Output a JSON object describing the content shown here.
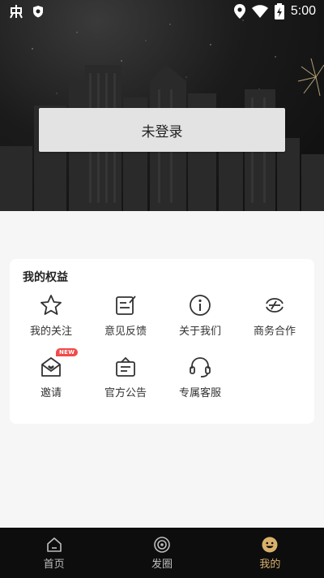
{
  "status_bar": {
    "time": "5:00",
    "left_icons": [
      "app-logo-icon",
      "shield-icon"
    ],
    "right_icons": [
      "location-icon",
      "wifi-icon",
      "battery-icon"
    ]
  },
  "login": {
    "label": "未登录"
  },
  "benefits": {
    "title": "我的权益",
    "items": [
      {
        "label": "我的关注",
        "icon": "star-icon"
      },
      {
        "label": "意见反馈",
        "icon": "feedback-icon"
      },
      {
        "label": "关于我们",
        "icon": "info-icon"
      },
      {
        "label": "商务合作",
        "icon": "cooperation-icon"
      },
      {
        "label": "邀请",
        "icon": "invite-icon",
        "badge": "NEW"
      },
      {
        "label": "官方公告",
        "icon": "announcement-icon"
      },
      {
        "label": "专属客服",
        "icon": "headset-icon"
      }
    ]
  },
  "bottom_nav": {
    "items": [
      {
        "label": "首页",
        "icon": "home-icon"
      },
      {
        "label": "发圈",
        "icon": "circle-icon"
      },
      {
        "label": "我的",
        "icon": "smile-icon",
        "active": true
      }
    ]
  },
  "colors": {
    "accent": "#d9b06b",
    "badge": "#f24a4a"
  }
}
